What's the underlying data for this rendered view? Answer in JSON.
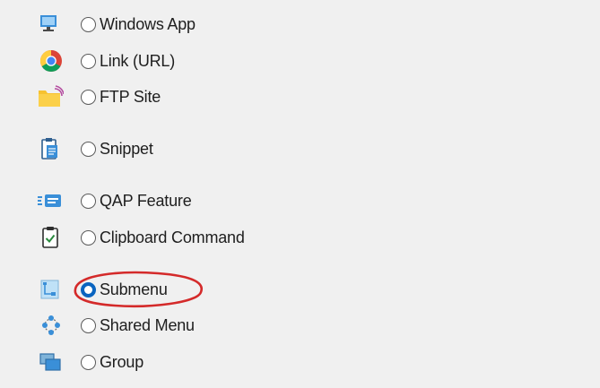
{
  "options": [
    {
      "label": "Windows App",
      "icon": "monitor-icon",
      "checked": false
    },
    {
      "label": "Link (URL)",
      "icon": "chrome-icon",
      "checked": false
    },
    {
      "label": "FTP Site",
      "icon": "ftp-folder-icon",
      "checked": false
    },
    {
      "label": "Snippet",
      "icon": "clipboard-note-icon",
      "checked": false
    },
    {
      "label": "QAP Feature",
      "icon": "qap-feature-icon",
      "checked": false
    },
    {
      "label": "Clipboard Command",
      "icon": "clipboard-check-icon",
      "checked": false
    },
    {
      "label": "Submenu",
      "icon": "submenu-icon",
      "checked": true
    },
    {
      "label": "Shared Menu",
      "icon": "shared-menu-icon",
      "checked": false
    },
    {
      "label": "Group",
      "icon": "group-icon",
      "checked": false
    }
  ],
  "colors": {
    "background": "#f0f0f0",
    "radio_selected": "#0a64c0",
    "annotation": "#d42a2a"
  }
}
